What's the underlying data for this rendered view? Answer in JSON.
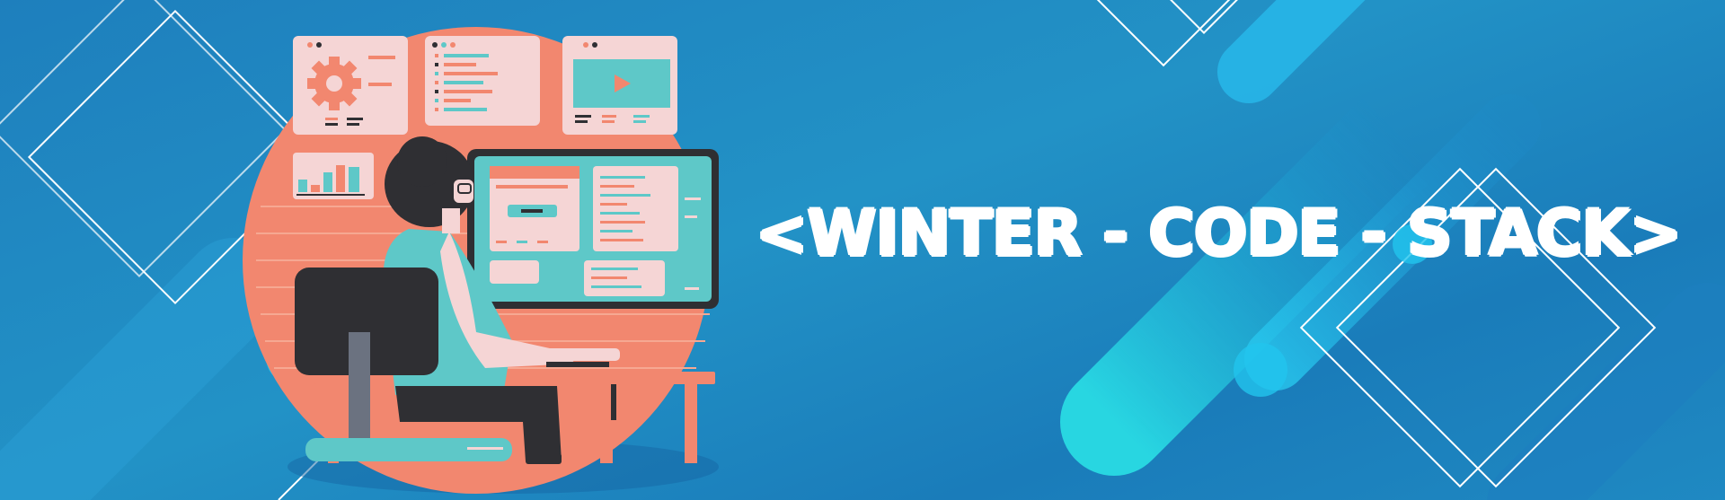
{
  "banner": {
    "title": "<WINTER - CODE - STACK>"
  },
  "colors": {
    "background": "#1e86c1",
    "accent_coral": "#f2876f",
    "panel_pink": "#f5d5d5",
    "screen_teal": "#5ec8c8",
    "dark": "#2f2f33",
    "cyan_highlight": "#22d2e6"
  },
  "icons": [
    "gear-icon",
    "play-icon",
    "bar-chart-icon",
    "code-lines-icon"
  ]
}
